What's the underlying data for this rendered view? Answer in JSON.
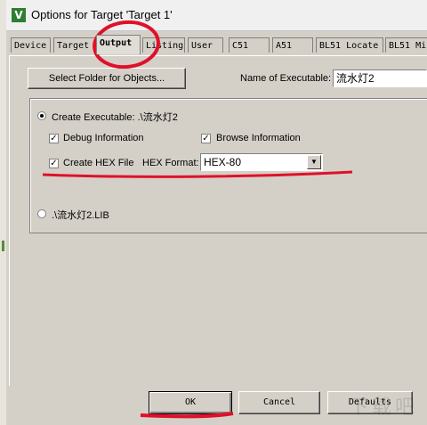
{
  "window": {
    "title": "Options for Target 'Target 1'",
    "icon_glyph": "V",
    "icon": "uvision-app-icon"
  },
  "tabs": [
    {
      "label": "Device",
      "active": false
    },
    {
      "label": "Target",
      "active": false
    },
    {
      "label": "Output",
      "active": true
    },
    {
      "label": "Listing",
      "active": false
    },
    {
      "label": "User",
      "active": false
    },
    {
      "label": "C51",
      "active": false
    },
    {
      "label": "A51",
      "active": false
    },
    {
      "label": "BL51 Locate",
      "active": false
    },
    {
      "label": "BL51 Mi",
      "active": false
    }
  ],
  "output": {
    "select_folder_label": "Select Folder for Objects...",
    "name_of_executable_label": "Name of Executable:",
    "name_of_executable_value": "流水灯2",
    "create_executable_label": "Create Executable:  .\\流水灯2",
    "create_executable_selected": true,
    "debug_info_label": "Debug Information",
    "debug_info_checked": true,
    "browse_info_label": "Browse Information",
    "browse_info_checked": true,
    "create_hex_label": "Create HEX File",
    "create_hex_checked": true,
    "hex_format_label": "HEX Format:",
    "hex_format_value": "HEX-80",
    "create_library_label": ".\\流水灯2.LIB",
    "create_library_selected": false,
    "check_glyph": "✓",
    "combo_arrow_glyph": "▼"
  },
  "footer": {
    "ok_label": "OK",
    "cancel_label": "Cancel",
    "defaults_label": "Defaults"
  },
  "watermark": "下载吧",
  "colors": {
    "dialog_bg": "#d4d0c8",
    "annotation_red": "#e0102a",
    "app_icon_green": "#2e7d32"
  }
}
